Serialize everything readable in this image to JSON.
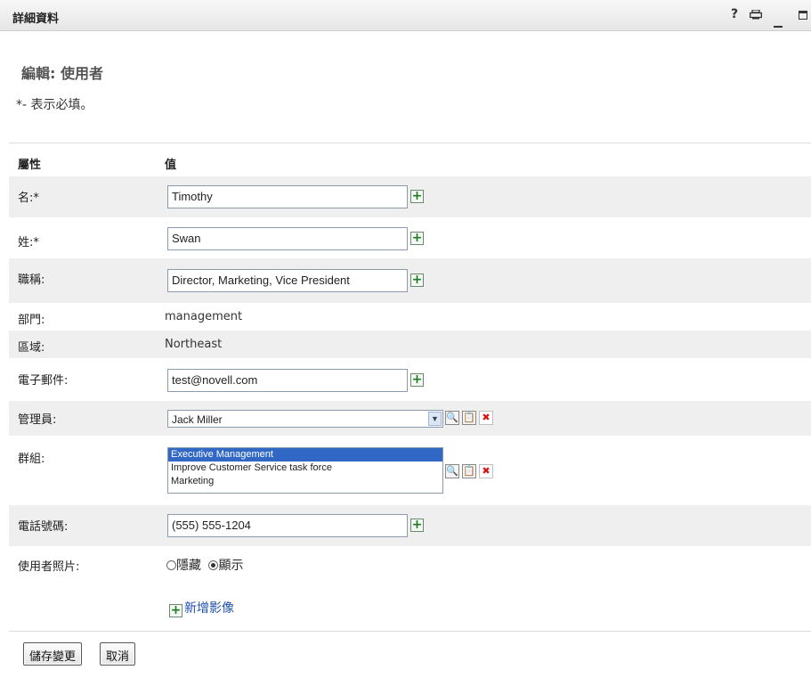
{
  "window": {
    "title": "詳細資料",
    "help_label": "?"
  },
  "form": {
    "title": "編輯: 使用者",
    "required_note": "*- 表示必填。",
    "col_attribute": "屬性",
    "col_value": "值"
  },
  "fields": {
    "first_name": {
      "label": "名:*",
      "value": "Timothy"
    },
    "last_name": {
      "label": "姓:*",
      "value": "Swan"
    },
    "job_title": {
      "label": "職稱:",
      "value": "Director, Marketing, Vice President"
    },
    "department": {
      "label": "部門:",
      "value": "management"
    },
    "region": {
      "label": "區域:",
      "value": "Northeast"
    },
    "email": {
      "label": "電子郵件:",
      "value": "test@novell.com"
    },
    "manager": {
      "label": "管理員:",
      "value": "Jack Miller"
    },
    "groups": {
      "label": "群組:",
      "items": [
        "Executive Management",
        "Improve Customer Service task force",
        "Marketing"
      ],
      "selected": "Executive Management"
    },
    "phone": {
      "label": "電話號碼:",
      "value": "(555) 555-1204"
    },
    "photo": {
      "label": "使用者照片:",
      "opt_hide": "隱藏",
      "opt_show": "顯示",
      "selected": "顯示",
      "add_image": "新增影像"
    }
  },
  "actions": {
    "save": "儲存變更",
    "cancel": "取消"
  },
  "colors": {
    "row_shade": "#efefef",
    "accent_plus": "#1e7a1e",
    "selection": "#3168c5",
    "delete": "#dd1111"
  }
}
